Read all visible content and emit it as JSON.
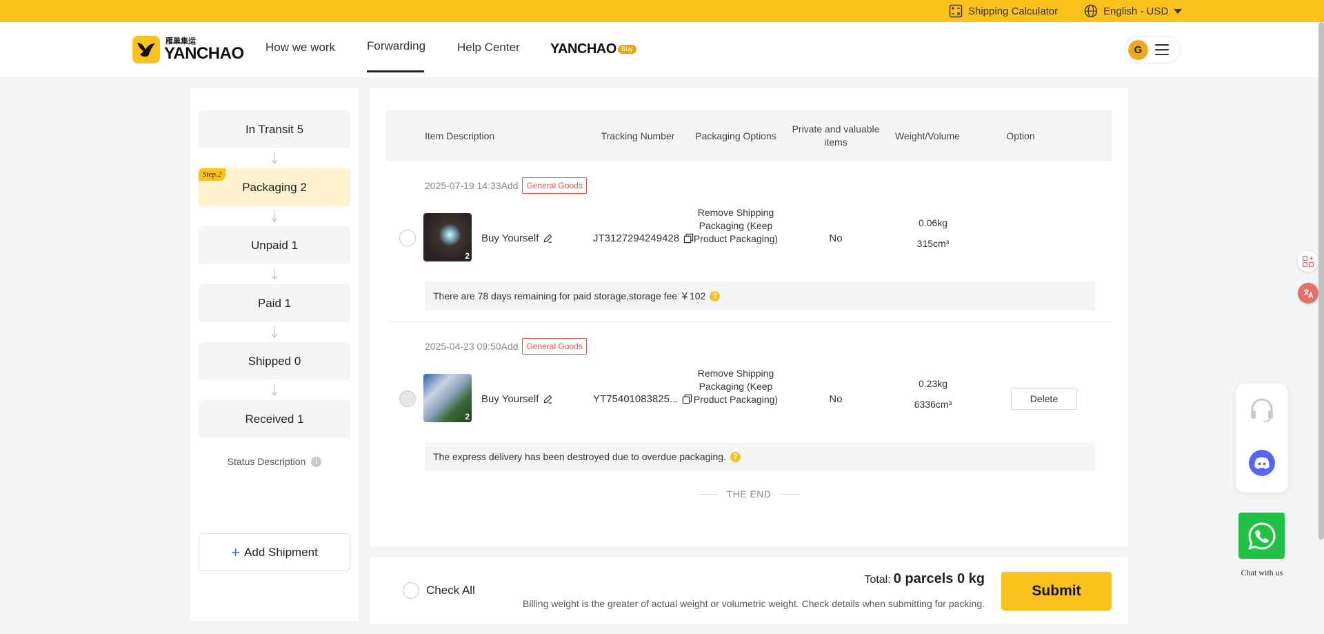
{
  "topbar": {
    "shipping_calculator": "Shipping Calculator",
    "language": "English - USD"
  },
  "header": {
    "logo_cn": "雁巢集运",
    "logo_en": "YANCHAO",
    "nav": {
      "how_we_work": "How we work",
      "forwarding": "Forwarding",
      "help_center": "Help Center"
    },
    "buy_logo_text": "YANCHAO",
    "buy_badge": "Buy",
    "avatar_letter": "G"
  },
  "sidebar": {
    "items": [
      {
        "label": "In Transit 5"
      },
      {
        "label": "Packaging 2",
        "step_badge": "Step.2"
      },
      {
        "label": "Unpaid 1"
      },
      {
        "label": "Paid 1"
      },
      {
        "label": "Shipped 0"
      },
      {
        "label": "Received 1"
      }
    ],
    "status_description": "Status Description",
    "add_shipment": "Add Shipment"
  },
  "table": {
    "headers": {
      "item_description": "Item Description",
      "tracking_number": "Tracking Number",
      "packaging_options": "Packaging Options",
      "private_valuable": "Private and valuable items",
      "weight_volume": "Weight/Volume",
      "option": "Option"
    },
    "rows": [
      {
        "date": "2025-07-19 14:33Add",
        "tag": "General Goods",
        "image_count": "2",
        "description": "Buy Yourself",
        "tracking": "JT3127294249428",
        "packaging": "Remove Shipping Packaging (Keep Product Packaging)",
        "private": "No",
        "weight": "0.06kg",
        "volume": "315cm³",
        "note": "There are 78 days remaining for paid storage,storage fee ￥102",
        "option": ""
      },
      {
        "date": "2025-04-23 09:50Add",
        "tag": "General Goods",
        "image_count": "2",
        "description": "Buy Yourself",
        "tracking": "YT75401083825...",
        "packaging": "Remove Shipping Packaging (Keep Product Packaging)",
        "private": "No",
        "weight": "0.23kg",
        "volume": "6336cm³",
        "note": "The express delivery has been destroyed due to overdue packaging.",
        "option": "Delete"
      }
    ],
    "end_text": "THE END"
  },
  "footer": {
    "check_all": "Check All",
    "total_label": "Total:",
    "total_value": "0 parcels 0 kg",
    "billing_note": "Billing weight is the greater of actual weight or volumetric weight. Check details when submitting for packing.",
    "submit": "Submit"
  },
  "support": {
    "chat_label": "Chat with us"
  },
  "colors": {
    "brand_yellow": "#fcc21b",
    "tag_red": "#e2574c",
    "whatsapp_green": "#1fc244",
    "discord_purple": "#5865f2"
  }
}
